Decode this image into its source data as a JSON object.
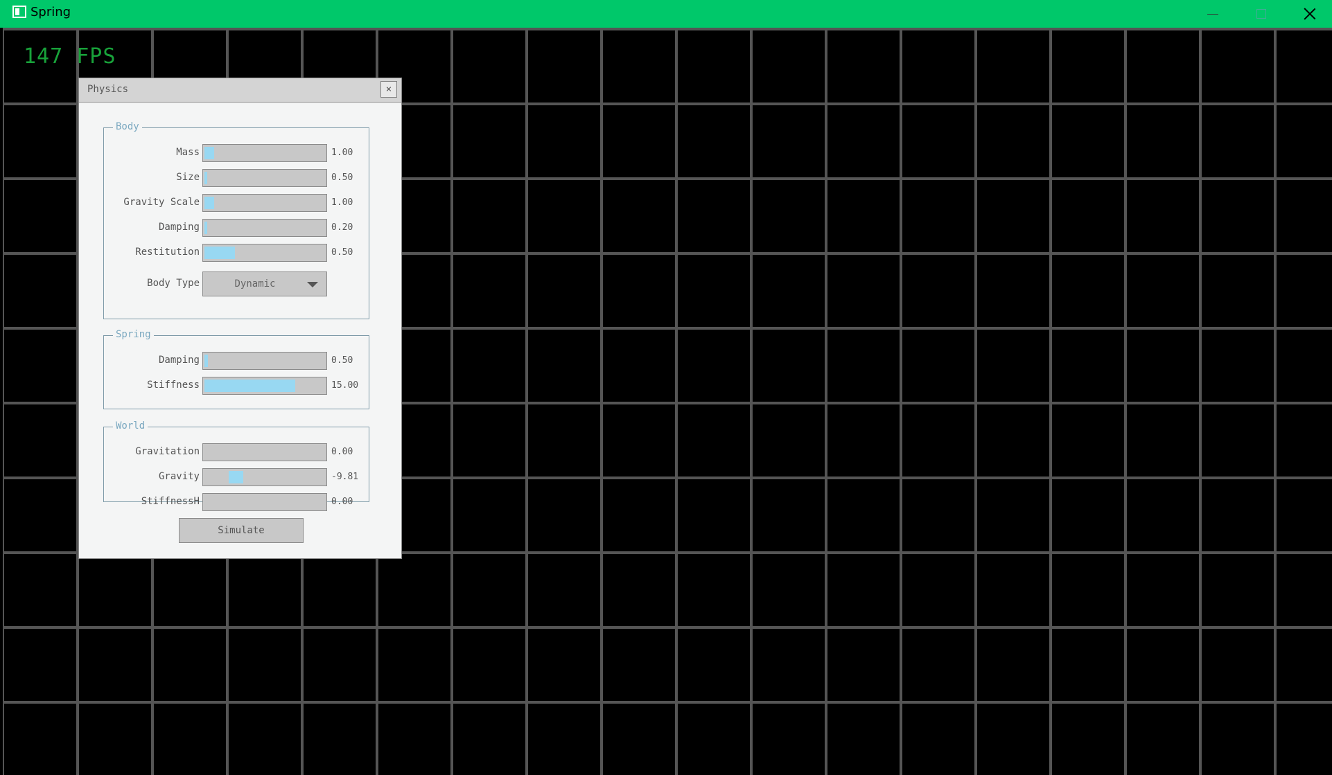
{
  "window": {
    "title": "Spring"
  },
  "overlay": {
    "fps": "147 FPS"
  },
  "panel": {
    "title": "Physics",
    "close_glyph": "×",
    "groups": {
      "body": {
        "label": "Body",
        "rows": [
          {
            "label": "Mass",
            "value": "1.00",
            "fill": 0.08
          },
          {
            "label": "Size",
            "value": "0.50",
            "fill": 0.02
          },
          {
            "label": "Gravity Scale",
            "value": "1.00",
            "fill": 0.08
          },
          {
            "label": "Damping",
            "value": "0.20",
            "fill": 0.02
          },
          {
            "label": "Restitution",
            "value": "0.50",
            "fill": 0.25
          }
        ],
        "body_type": {
          "label": "Body Type",
          "value": "Dynamic"
        }
      },
      "spring": {
        "label": "Spring",
        "rows": [
          {
            "label": "Damping",
            "value": "0.50",
            "fill": 0.03
          },
          {
            "label": "Stiffness",
            "value": "15.00",
            "fill": 0.75
          }
        ]
      },
      "world": {
        "label": "World",
        "rows": [
          {
            "label": "Gravitation",
            "value": "0.00",
            "fill": 0
          },
          {
            "label": "Gravity",
            "value": "-9.81",
            "fill": 0.12,
            "fill_start": 0.2
          },
          {
            "label": "StiffnessH",
            "value": "0.00",
            "fill": 0
          }
        ]
      }
    },
    "simulate_label": "Simulate"
  },
  "colors": {
    "titlebar": "#00c86a",
    "grid": "#555555",
    "fps": "#18a23a",
    "slider_fill": "#98d8f2",
    "group_label": "#7aa8c0"
  },
  "icons": [
    "app-icon",
    "minimize-icon",
    "maximize-icon",
    "close-icon",
    "chevron-down-icon"
  ]
}
